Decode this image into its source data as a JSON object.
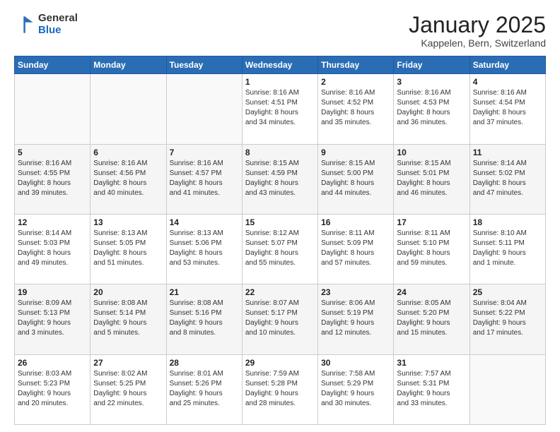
{
  "header": {
    "logo": {
      "general": "General",
      "blue": "Blue"
    },
    "title": "January 2025",
    "location": "Kappelen, Bern, Switzerland"
  },
  "weekdays": [
    "Sunday",
    "Monday",
    "Tuesday",
    "Wednesday",
    "Thursday",
    "Friday",
    "Saturday"
  ],
  "weeks": [
    [
      {
        "day": "",
        "info": ""
      },
      {
        "day": "",
        "info": ""
      },
      {
        "day": "",
        "info": ""
      },
      {
        "day": "1",
        "info": "Sunrise: 8:16 AM\nSunset: 4:51 PM\nDaylight: 8 hours\nand 34 minutes."
      },
      {
        "day": "2",
        "info": "Sunrise: 8:16 AM\nSunset: 4:52 PM\nDaylight: 8 hours\nand 35 minutes."
      },
      {
        "day": "3",
        "info": "Sunrise: 8:16 AM\nSunset: 4:53 PM\nDaylight: 8 hours\nand 36 minutes."
      },
      {
        "day": "4",
        "info": "Sunrise: 8:16 AM\nSunset: 4:54 PM\nDaylight: 8 hours\nand 37 minutes."
      }
    ],
    [
      {
        "day": "5",
        "info": "Sunrise: 8:16 AM\nSunset: 4:55 PM\nDaylight: 8 hours\nand 39 minutes."
      },
      {
        "day": "6",
        "info": "Sunrise: 8:16 AM\nSunset: 4:56 PM\nDaylight: 8 hours\nand 40 minutes."
      },
      {
        "day": "7",
        "info": "Sunrise: 8:16 AM\nSunset: 4:57 PM\nDaylight: 8 hours\nand 41 minutes."
      },
      {
        "day": "8",
        "info": "Sunrise: 8:15 AM\nSunset: 4:59 PM\nDaylight: 8 hours\nand 43 minutes."
      },
      {
        "day": "9",
        "info": "Sunrise: 8:15 AM\nSunset: 5:00 PM\nDaylight: 8 hours\nand 44 minutes."
      },
      {
        "day": "10",
        "info": "Sunrise: 8:15 AM\nSunset: 5:01 PM\nDaylight: 8 hours\nand 46 minutes."
      },
      {
        "day": "11",
        "info": "Sunrise: 8:14 AM\nSunset: 5:02 PM\nDaylight: 8 hours\nand 47 minutes."
      }
    ],
    [
      {
        "day": "12",
        "info": "Sunrise: 8:14 AM\nSunset: 5:03 PM\nDaylight: 8 hours\nand 49 minutes."
      },
      {
        "day": "13",
        "info": "Sunrise: 8:13 AM\nSunset: 5:05 PM\nDaylight: 8 hours\nand 51 minutes."
      },
      {
        "day": "14",
        "info": "Sunrise: 8:13 AM\nSunset: 5:06 PM\nDaylight: 8 hours\nand 53 minutes."
      },
      {
        "day": "15",
        "info": "Sunrise: 8:12 AM\nSunset: 5:07 PM\nDaylight: 8 hours\nand 55 minutes."
      },
      {
        "day": "16",
        "info": "Sunrise: 8:11 AM\nSunset: 5:09 PM\nDaylight: 8 hours\nand 57 minutes."
      },
      {
        "day": "17",
        "info": "Sunrise: 8:11 AM\nSunset: 5:10 PM\nDaylight: 8 hours\nand 59 minutes."
      },
      {
        "day": "18",
        "info": "Sunrise: 8:10 AM\nSunset: 5:11 PM\nDaylight: 9 hours\nand 1 minute."
      }
    ],
    [
      {
        "day": "19",
        "info": "Sunrise: 8:09 AM\nSunset: 5:13 PM\nDaylight: 9 hours\nand 3 minutes."
      },
      {
        "day": "20",
        "info": "Sunrise: 8:08 AM\nSunset: 5:14 PM\nDaylight: 9 hours\nand 5 minutes."
      },
      {
        "day": "21",
        "info": "Sunrise: 8:08 AM\nSunset: 5:16 PM\nDaylight: 9 hours\nand 8 minutes."
      },
      {
        "day": "22",
        "info": "Sunrise: 8:07 AM\nSunset: 5:17 PM\nDaylight: 9 hours\nand 10 minutes."
      },
      {
        "day": "23",
        "info": "Sunrise: 8:06 AM\nSunset: 5:19 PM\nDaylight: 9 hours\nand 12 minutes."
      },
      {
        "day": "24",
        "info": "Sunrise: 8:05 AM\nSunset: 5:20 PM\nDaylight: 9 hours\nand 15 minutes."
      },
      {
        "day": "25",
        "info": "Sunrise: 8:04 AM\nSunset: 5:22 PM\nDaylight: 9 hours\nand 17 minutes."
      }
    ],
    [
      {
        "day": "26",
        "info": "Sunrise: 8:03 AM\nSunset: 5:23 PM\nDaylight: 9 hours\nand 20 minutes."
      },
      {
        "day": "27",
        "info": "Sunrise: 8:02 AM\nSunset: 5:25 PM\nDaylight: 9 hours\nand 22 minutes."
      },
      {
        "day": "28",
        "info": "Sunrise: 8:01 AM\nSunset: 5:26 PM\nDaylight: 9 hours\nand 25 minutes."
      },
      {
        "day": "29",
        "info": "Sunrise: 7:59 AM\nSunset: 5:28 PM\nDaylight: 9 hours\nand 28 minutes."
      },
      {
        "day": "30",
        "info": "Sunrise: 7:58 AM\nSunset: 5:29 PM\nDaylight: 9 hours\nand 30 minutes."
      },
      {
        "day": "31",
        "info": "Sunrise: 7:57 AM\nSunset: 5:31 PM\nDaylight: 9 hours\nand 33 minutes."
      },
      {
        "day": "",
        "info": ""
      }
    ]
  ]
}
